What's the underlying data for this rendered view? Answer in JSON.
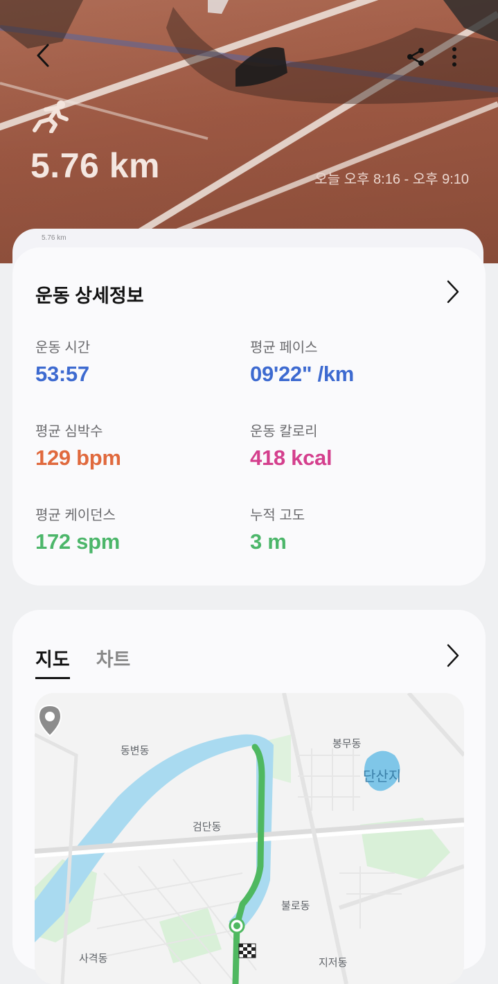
{
  "header": {
    "distance": "5.76 km",
    "time_range": "오늘 오후 8:16 - 오후 9:10",
    "back_label_small": "5.76 km"
  },
  "details": {
    "title": "운동 상세정보",
    "metrics": [
      {
        "label": "운동 시간",
        "value": "53:57",
        "color": "#3d6ad0"
      },
      {
        "label": "평균 페이스",
        "value": "09'22\" /km",
        "color": "#3d6ad0"
      },
      {
        "label": "평균 심박수",
        "value": "129 bpm",
        "color": "#e0693d"
      },
      {
        "label": "운동 칼로리",
        "value": "418 kcal",
        "color": "#d43f8d"
      },
      {
        "label": "평균 케이던스",
        "value": "172 spm",
        "color": "#4cb66a"
      },
      {
        "label": "누적 고도",
        "value": "3 m",
        "color": "#4cb66a"
      }
    ]
  },
  "map_section": {
    "tabs": [
      "지도",
      "차트"
    ],
    "active_tab": "지도",
    "labels": {
      "dongbyeon": "동변동",
      "bongmu": "봉무동",
      "dansanji": "단산지",
      "geomdan": "검단동",
      "bullo": "불로동",
      "sagyeok": "사격동",
      "jijeo": "지저동"
    },
    "route_color": "#4fb860"
  },
  "icons": {
    "back": "chevron-left-icon",
    "share": "share-icon",
    "more": "more-vertical-icon",
    "running": "running-icon",
    "details_arrow": "chevron-right-icon",
    "map_arrow": "chevron-right-icon",
    "location_pin": "location-pin-icon",
    "finish_flag": "finish-flag-icon"
  }
}
